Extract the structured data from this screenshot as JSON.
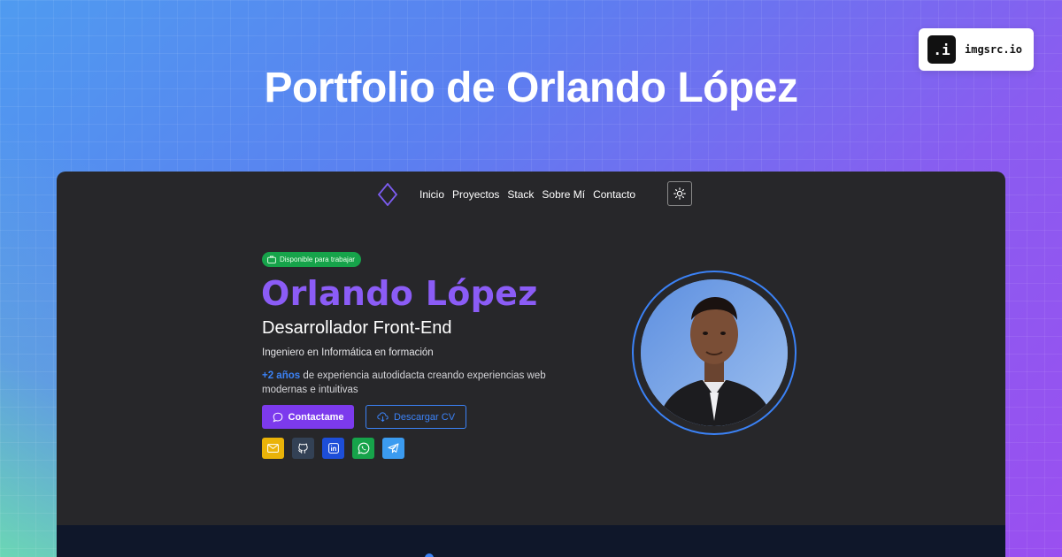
{
  "colors": {
    "accent_purple": "#8b5cf6",
    "accent_blue": "#3b82f6",
    "badge_green": "#16a34a",
    "window_bg": "#27272a"
  },
  "brand": {
    "logo_text": ".i",
    "name": "imgsrc.io"
  },
  "page": {
    "heading": "Portfolio de Orlando López"
  },
  "nav": {
    "logo_icon": "diamond-logo-icon",
    "items": [
      {
        "label": "Inicio"
      },
      {
        "label": "Proyectos"
      },
      {
        "label": "Stack"
      },
      {
        "label": "Sobre Mí"
      },
      {
        "label": "Contacto"
      }
    ],
    "theme_toggle_icon": "sun-icon"
  },
  "hero": {
    "availability": "Disponible para trabajar",
    "name": "Orlando López",
    "role": "Desarrollador Front-End",
    "subtitle": "Ingeniero en Informática en formación",
    "experience_highlight": "+2 años",
    "experience_text": " de experiencia autodidacta creando experiencias web modernas e intuitivas",
    "contact_button": "Contactame",
    "cv_button": "Descargar CV",
    "socials": [
      {
        "name": "email",
        "icon": "mail-icon",
        "color": "#eab308"
      },
      {
        "name": "github",
        "icon": "github-icon",
        "color": "#334155"
      },
      {
        "name": "linkedin",
        "icon": "linkedin-icon",
        "color": "#1d4ed8"
      },
      {
        "name": "whatsapp",
        "icon": "whatsapp-icon",
        "color": "#16a34a"
      },
      {
        "name": "telegram",
        "icon": "telegram-icon",
        "color": "#3b9bf0"
      }
    ]
  }
}
